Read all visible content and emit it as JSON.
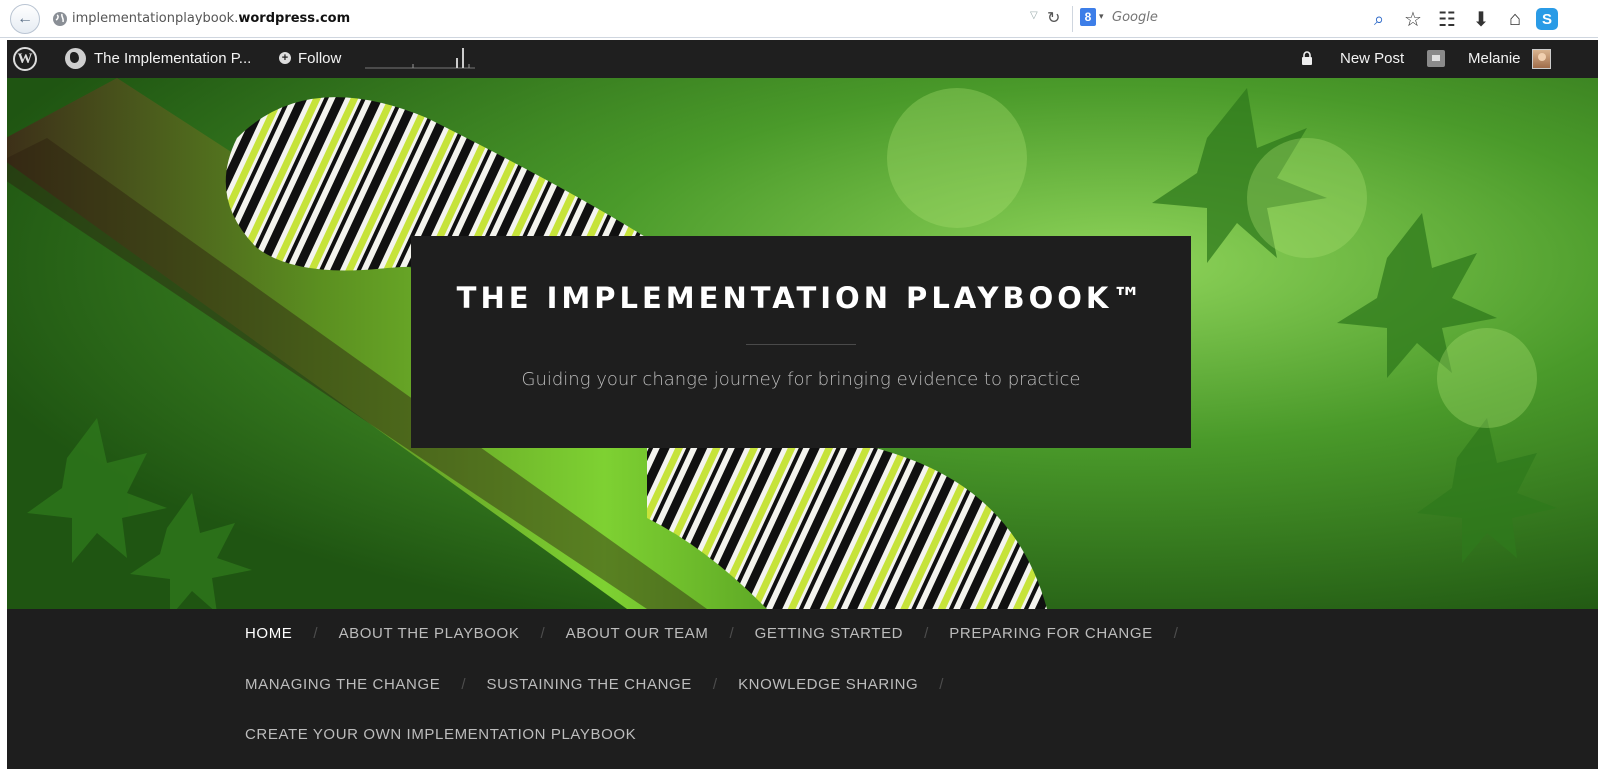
{
  "browser": {
    "url_prefix": "implementationplaybook.",
    "url_domain": "wordpress.com",
    "search_placeholder": "Google",
    "search_engine_icon": "google-plus-icon"
  },
  "admin_bar": {
    "site_name": "The Implementation P...",
    "follow_label": "Follow",
    "new_post_label": "New Post",
    "user_name": "Melanie"
  },
  "hero": {
    "title": "THE IMPLEMENTATION PLAYBOOK™",
    "tagline": "Guiding your change journey for bringing evidence to practice"
  },
  "nav": {
    "row1": [
      "HOME",
      "ABOUT THE PLAYBOOK",
      "ABOUT OUR TEAM",
      "GETTING STARTED",
      "PREPARING FOR CHANGE"
    ],
    "row2": [
      "MANAGING THE CHANGE",
      "SUSTAINING THE CHANGE",
      "KNOWLEDGE SHARING"
    ],
    "row3": [
      "CREATE YOUR OWN IMPLEMENTATION PLAYBOOK"
    ],
    "separator": "/"
  }
}
